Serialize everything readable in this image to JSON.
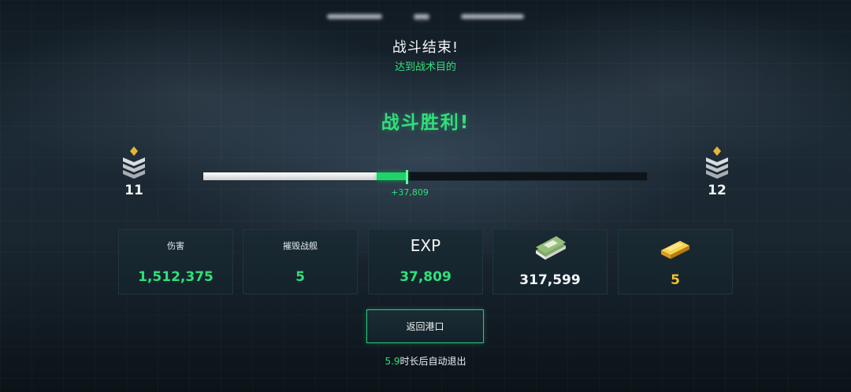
{
  "header": {
    "clock": "--:--",
    "title": "战斗结束!",
    "subtitle": "达到战术目的"
  },
  "result": {
    "victory": "战斗胜利!"
  },
  "rank": {
    "current_level": "11",
    "next_level": "12"
  },
  "progress": {
    "previous_fraction": 0.39,
    "gain_fraction": 0.07,
    "gain_label": "+37,809"
  },
  "stats": [
    {
      "label": "伤害",
      "value": "1,512,375"
    },
    {
      "label": "摧毁战舰",
      "value": "5"
    },
    {
      "label": "EXP",
      "value": "37,809"
    },
    {
      "icon": "cash-stack-icon",
      "value": "317,599"
    },
    {
      "icon": "gold-bar-icon",
      "value": "5"
    }
  ],
  "actions": {
    "return_label": "返回港口",
    "countdown": "5.9",
    "auto_exit_text": "时长后自动退出"
  },
  "colors": {
    "accent_green": "#2fe07a",
    "gold": "#f1c232"
  }
}
